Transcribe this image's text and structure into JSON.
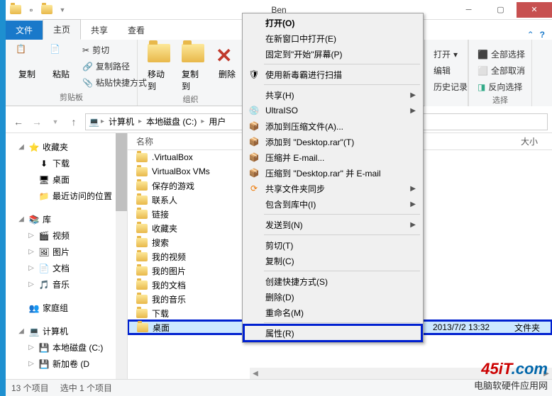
{
  "window": {
    "title": "Ben"
  },
  "ribbon_tabs": {
    "file": "文件",
    "home": "主页",
    "share": "共享",
    "view": "查看"
  },
  "clipboard_group": {
    "copy": "复制",
    "paste": "粘贴",
    "cut": "剪切",
    "copy_path": "复制路径",
    "paste_shortcut": "粘贴快捷方式",
    "label": "剪贴板"
  },
  "organize_group": {
    "move_to": "移动到",
    "copy_to": "复制到",
    "delete": "删除",
    "label": "组织"
  },
  "open_group": {
    "open": "打开",
    "edit": "编辑",
    "history": "历史记录"
  },
  "select_group": {
    "select_all": "全部选择",
    "select_none": "全部取消",
    "invert": "反向选择",
    "label": "选择"
  },
  "breadcrumb": {
    "computer": "计算机",
    "drive": "本地磁盘 (C:)",
    "users": "用户"
  },
  "tree": {
    "favorites": "收藏夹",
    "downloads": "下载",
    "desktop": "桌面",
    "recent": "最近访问的位置",
    "libraries": "库",
    "videos": "视频",
    "pictures": "图片",
    "documents": "文档",
    "music": "音乐",
    "homegroup": "家庭组",
    "computer": "计算机",
    "drive_c": "本地磁盘 (C:)",
    "drive_new": "新加卷 (D"
  },
  "columns": {
    "name": "名称",
    "size": "大小"
  },
  "items": [
    ".VirtualBox",
    "VirtualBox VMs",
    "保存的游戏",
    "联系人",
    "链接",
    "收藏夹",
    "搜索",
    "我的视频",
    "我的图片",
    "我的文档",
    "我的音乐",
    "下载",
    "桌面"
  ],
  "row_meta": {
    "date": "2013/7/2 13:32",
    "type": "文件夹"
  },
  "context_menu": {
    "open": "打开(O)",
    "open_new_window": "在新窗口中打开(E)",
    "pin_start": "固定到\"开始\"屏幕(P)",
    "scan": "使用新毒霸进行扫描",
    "share": "共享(H)",
    "ultraiso": "UltraISO",
    "add_archive": "添加到压缩文件(A)...",
    "add_desktop_rar": "添加到 \"Desktop.rar\"(T)",
    "compress_email": "压缩并 E-mail...",
    "compress_desktop_email": "压缩到 \"Desktop.rar\" 并 E-mail",
    "sync_folder": "共享文件夹同步",
    "include_library": "包含到库中(I)",
    "send_to": "发送到(N)",
    "cut": "剪切(T)",
    "copy": "复制(C)",
    "create_shortcut": "创建快捷方式(S)",
    "delete": "删除(D)",
    "rename": "重命名(M)",
    "properties": "属性(R)"
  },
  "status": {
    "count": "13 个项目",
    "selected": "选中 1 个项目"
  },
  "watermark": {
    "logo_a": "45iT",
    "logo_b": ".com",
    "sub": "电脑软硬件应用网"
  }
}
